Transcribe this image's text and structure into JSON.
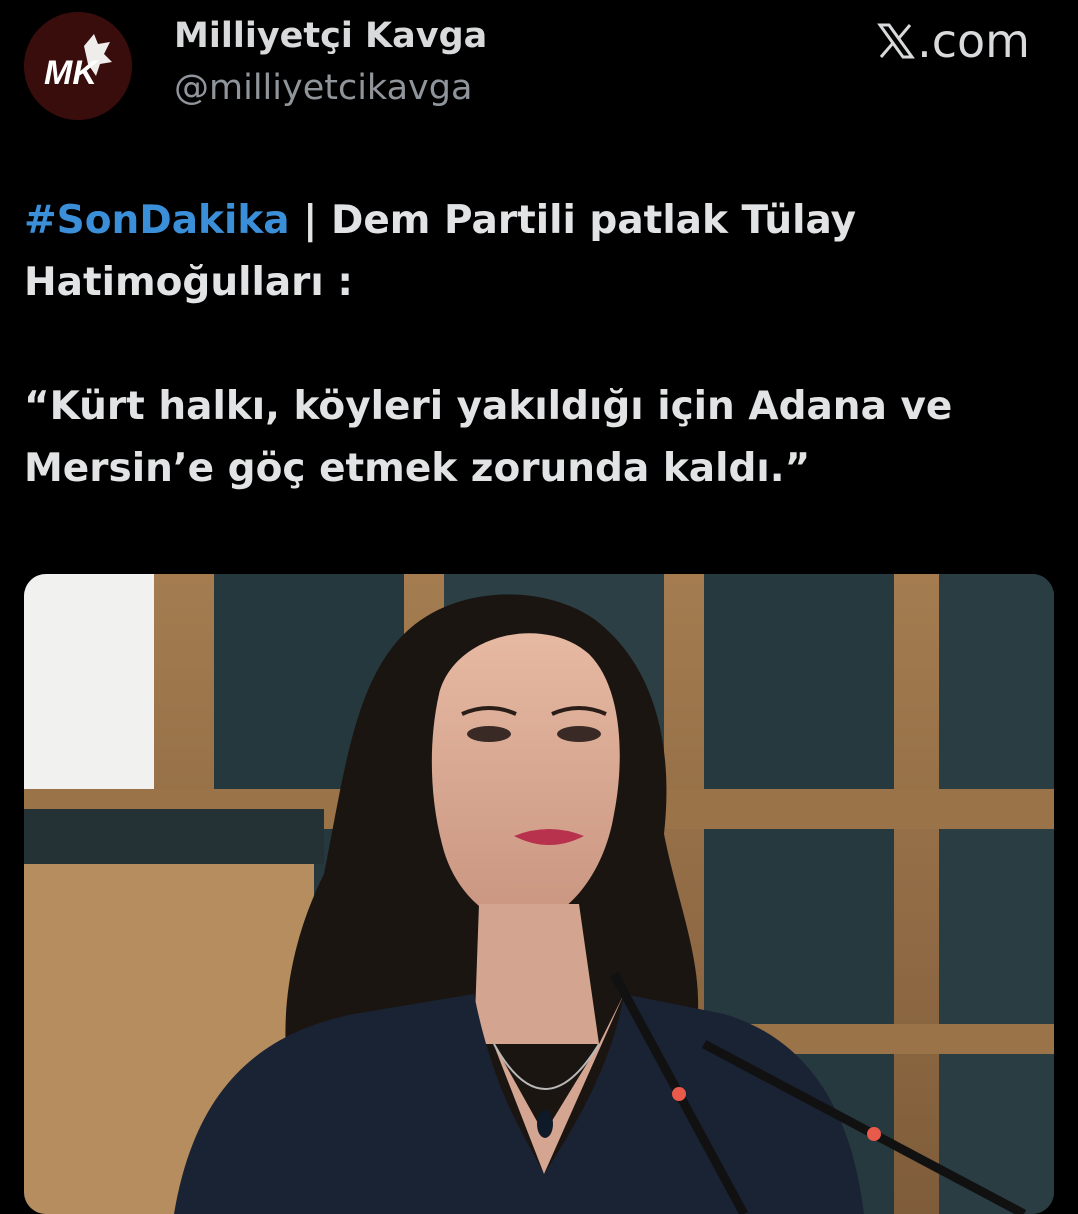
{
  "account": {
    "display_name": "Milliyetçi Kavga",
    "handle": "@milliyetcikavga",
    "avatar_initials": "MK",
    "avatar_icon": "wolf-logo-icon"
  },
  "source": {
    "x_glyph": "𝕏",
    "suffix": ".com",
    "icon": "x-logo-icon"
  },
  "tweet": {
    "hashtag": "#SonDakika",
    "separator": " | ",
    "headline": "Dem Partili patlak Tülay Hatimoğulları :",
    "quote": "“Kürt halkı, köyleri yakıldığı için Adana ve Mersin’e göç etmek zorunda kaldı.”"
  },
  "media": {
    "type": "photo",
    "icon": "photo-attachment"
  },
  "colors": {
    "background": "#000000",
    "text": "#e2e3e4",
    "muted": "#8f959a",
    "hashtag": "#3b8fd9"
  }
}
